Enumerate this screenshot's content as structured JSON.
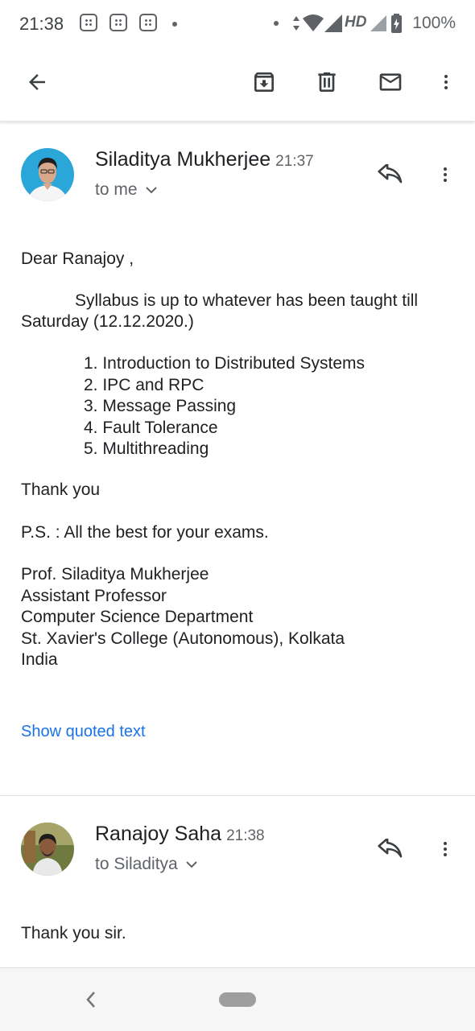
{
  "status_bar": {
    "time": "21:38",
    "network": "HD",
    "battery": "100%"
  },
  "toolbar": {
    "back_icon": "arrow-left-icon",
    "archive_icon": "archive-icon",
    "delete_icon": "trash-icon",
    "mark_unread_icon": "mail-icon",
    "more_icon": "more-vert-icon"
  },
  "messages": [
    {
      "sender": "Siladitya Mukherjee",
      "time": "21:37",
      "recipient": "to me",
      "body": {
        "greeting": "Dear Ranajoy ,",
        "line1": "Syllabus is up to whatever has been taught till",
        "line2": "Saturday (12.12.2020.)",
        "topics": [
          "1. Introduction to Distributed Systems",
          "2. IPC and RPC",
          "3. Message Passing",
          "4. Fault Tolerance",
          "5. Multithreading"
        ],
        "thanks": "Thank you",
        "ps": "P.S. : All the best for your exams.",
        "signature": [
          "Prof. Siladitya Mukherjee",
          "Assistant Professor",
          "Computer Science Department",
          "St. Xavier's College (Autonomous), Kolkata",
          "India"
        ]
      },
      "show_quoted": "Show quoted text"
    },
    {
      "sender": "Ranajoy Saha",
      "time": "21:38",
      "recipient": "to Siladitya",
      "body": "Thank you sir."
    }
  ],
  "colors": {
    "link": "#1a73e8",
    "icon": "#5f6368",
    "text": "#202124"
  }
}
